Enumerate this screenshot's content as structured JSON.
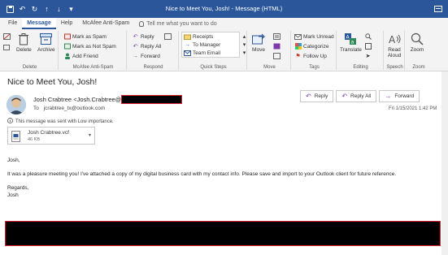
{
  "window": {
    "title": "Nice to Meet You, Josh! - Message (HTML)"
  },
  "tabs": [
    "File",
    "Message",
    "Help",
    "McAfee Anti-Spam"
  ],
  "tell_me": "Tell me what you want to do",
  "ribbon": {
    "delete_group": {
      "label": "Delete",
      "delete": "Delete",
      "archive": "Archive"
    },
    "mcafee_group": {
      "label": "McAfee Anti-Spam",
      "mark_spam": "Mark as Spam",
      "mark_not_spam": "Mark as Not Spam",
      "add_friend": "Add Friend"
    },
    "respond_group": {
      "label": "Respond",
      "reply": "Reply",
      "reply_all": "Reply All",
      "forward": "Forward"
    },
    "quick_steps_group": {
      "label": "Quick Steps",
      "items": [
        "Receipts",
        "To Manager",
        "Team Email"
      ]
    },
    "move_group": {
      "label": "Move",
      "move": "Move"
    },
    "tags_group": {
      "label": "Tags",
      "mark_unread": "Mark Unread",
      "categorize": "Categorize",
      "follow_up": "Follow Up"
    },
    "editing_group": {
      "label": "Editing",
      "translate": "Translate"
    },
    "speech_group": {
      "label": "Speech",
      "read_aloud": "Read\nAloud"
    },
    "zoom_group": {
      "label": "Zoom",
      "zoom": "Zoom"
    }
  },
  "message": {
    "subject": "Nice to Meet You, Josh!",
    "from_prefix": "Josh Crabtree <Josh.Crabtree@",
    "to_label": "To",
    "to_value": "jcrabtree_tx@outlook.com",
    "datetime": "Fri 1/15/2021 1:42 PM",
    "importance_note": "This message was sent with Low importance.",
    "attachment": {
      "name": "Josh Crabtree.vcf",
      "size": "46 KB"
    },
    "actions": {
      "reply": "Reply",
      "reply_all": "Reply All",
      "forward": "Forward"
    },
    "body": {
      "greeting": "Josh,",
      "paragraph": "It was a pleasure meeting you! I've attached a copy of my digital business card with my contact info. Please save and import to your Outlook client for future reference.",
      "signoff": "Regards,",
      "name": "Josh"
    }
  },
  "colors": {
    "titlebar": "#2b579a",
    "accent": "#2b579a",
    "redaction_border": "#d9202f"
  }
}
